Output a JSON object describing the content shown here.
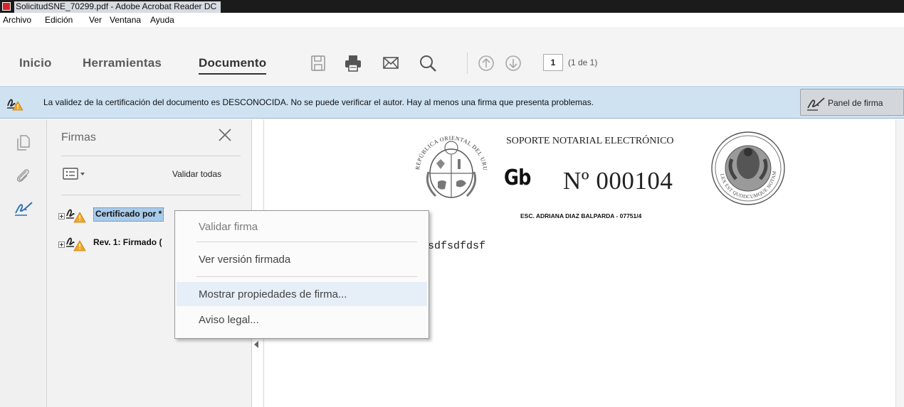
{
  "window": {
    "title": "SolicitudSNE_70299.pdf - Adobe Acrobat Reader DC"
  },
  "menubar": {
    "items": [
      "Archivo",
      "Edición",
      "Ver",
      "Ventana",
      "Ayuda"
    ]
  },
  "toolbar": {
    "tabs": [
      "Inicio",
      "Herramientas",
      "Documento"
    ],
    "active_tab": "Documento",
    "icons": [
      "save-icon",
      "print-icon",
      "email-icon",
      "search-icon",
      "page-up-icon",
      "page-down-icon"
    ],
    "page_current": "1",
    "page_of": "(1 de 1)"
  },
  "banner": {
    "message": "La validez de la certificación del documento es DESCONOCIDA. No se puede verificar el autor. Hay al menos una firma que presenta problemas.",
    "panel_button": "Panel de firma"
  },
  "signature_panel": {
    "title": "Firmas",
    "validate_all": "Validar todas",
    "rows": [
      {
        "label": "Certificado por *",
        "selected": true
      },
      {
        "label": "Rev. 1: Firmado (",
        "selected": false
      }
    ]
  },
  "context_menu": {
    "items": [
      {
        "label": "Validar firma",
        "enabled": false
      },
      {
        "label": "Ver versión firmada",
        "enabled": true
      },
      {
        "label": "Mostrar propiedades de firma...",
        "enabled": true,
        "highlighted": true
      },
      {
        "label": "Aviso legal...",
        "enabled": true
      }
    ]
  },
  "document": {
    "seal_left_text": "REPÚBLICA ORIENTAL DEL URUGUAY",
    "seal_right_text": "LEX EST QUODCUMQUE NOTAMUS",
    "header": "SOPORTE NOTARIAL ELECTRÓNICO",
    "series": "Gb",
    "number": "Nº 000104",
    "escribano": "ESC. ADRIANA DIAZ BALPARDA - 07751/4",
    "body_text": "sdfsdfdsf"
  },
  "colors": {
    "banner_bg": "#cfe2f2",
    "menu_highlight": "#e6eef7",
    "selection": "#a9cbea",
    "warning": "#f5a623"
  }
}
